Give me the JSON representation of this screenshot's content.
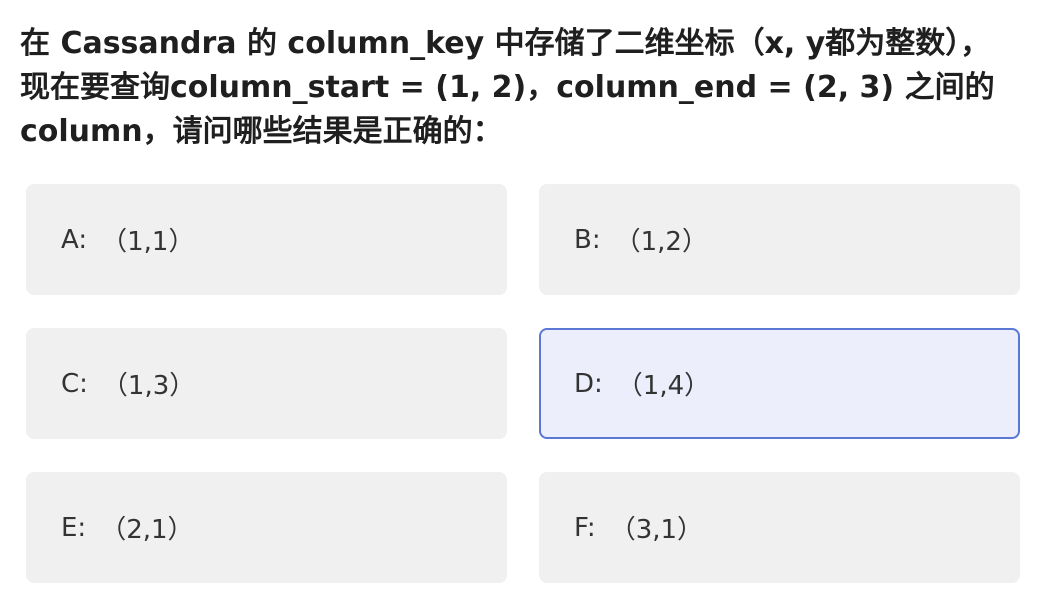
{
  "question": {
    "text": "在 Cassandra 的 column_key 中存储了二维坐标（x, y都为整数），现在要查询column_start = (1, 2)，column_end = (2, 3) 之间的 column，请问哪些结果是正确的："
  },
  "options": [
    {
      "letter": "A:",
      "value": "（1,1）",
      "selected": false
    },
    {
      "letter": "B:",
      "value": "（1,2）",
      "selected": false
    },
    {
      "letter": "C:",
      "value": "（1,3）",
      "selected": false
    },
    {
      "letter": "D:",
      "value": "（1,4）",
      "selected": true
    },
    {
      "letter": "E:",
      "value": "（2,1）",
      "selected": false
    },
    {
      "letter": "F:",
      "value": "（3,1）",
      "selected": false
    }
  ],
  "colors": {
    "option_bg": "#f0f0f0",
    "selected_bg": "#eceffb",
    "selected_border": "#5a78d4"
  }
}
